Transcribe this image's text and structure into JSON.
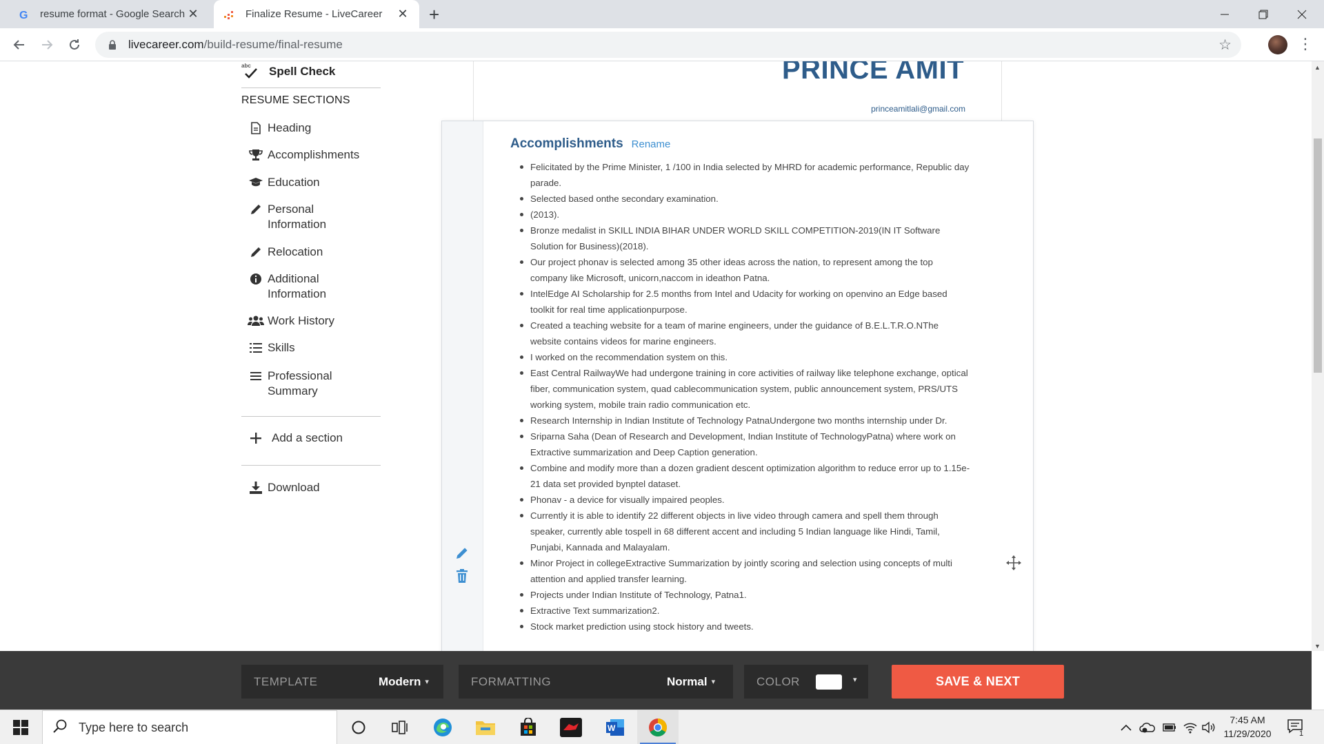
{
  "browser": {
    "tabs": [
      {
        "title": "resume format - Google Search",
        "active": false
      },
      {
        "title": "Finalize Resume - LiveCareer",
        "active": true
      }
    ],
    "url_domain": "livecareer.com",
    "url_path": "/build-resume/final-resume"
  },
  "sidebar": {
    "spell_check": "Spell Check",
    "spell_check_icon_text": "abc",
    "sections_heading": "RESUME SECTIONS",
    "items": [
      {
        "label": "Heading",
        "icon": "document-icon"
      },
      {
        "label": "Accomplishments",
        "icon": "trophy-icon"
      },
      {
        "label": "Education",
        "icon": "graduation-cap-icon"
      },
      {
        "label": "Personal Information",
        "icon": "pencil-icon"
      },
      {
        "label": "Relocation",
        "icon": "pencil-icon"
      },
      {
        "label": "Additional Information",
        "icon": "info-icon"
      },
      {
        "label": "Work History",
        "icon": "users-icon"
      },
      {
        "label": "Skills",
        "icon": "list-icon"
      },
      {
        "label": "Professional Summary",
        "icon": "menu-icon"
      }
    ],
    "add_section": "Add a section",
    "download": "Download"
  },
  "resume": {
    "name": "PRINCE AMIT",
    "email": "princeamitlali@gmail.com",
    "section_title": "Accomplishments",
    "rename_label": "Rename",
    "bullets": [
      "Felicitated by the Prime Minister, 1 /100 in India selected by MHRD for academic performance, Republic day parade.",
      "Selected based onthe secondary examination.",
      "(2013).",
      "Bronze medalist in SKILL INDIA BIHAR UNDER WORLD SKILL COMPETITION-2019(IN IT Software Solution for Business)(2018).",
      "Our project phonav is selected among 35 other ideas across the nation, to represent among the top company like Microsoft, unicorn,naccom in ideathon Patna.",
      "IntelEdge AI Scholarship for 2.5 months from Intel and Udacity for working on openvino an Edge based toolkit for real time applicationpurpose.",
      "Created a teaching website for a team of marine engineers, under the guidance of B.E.L.T.R.O.NThe website contains videos for marine engineers.",
      "I worked on the recommendation system on this.",
      "East Central RailwayWe had undergone training in core activities of railway like telephone exchange, optical fiber, communication system, quad cablecommunication system, public announcement system, PRS/UTS working system, mobile train radio communication etc.",
      "Research Internship in Indian Institute of Technology PatnaUndergone two months internship under Dr.",
      "Sriparna Saha (Dean of Research and Development, Indian Institute of TechnologyPatna) where work on Extractive summarization and Deep Caption generation.",
      "Combine and modify more than a dozen gradient descent optimization algorithm to reduce error up to 1.15e-21 data set provided bynptel dataset.",
      "Phonav - a device for visually impaired peoples.",
      "Currently it is able to identify 22 different objects in live video through camera and spell them through speaker, currently able tospell in 68 different accent and including 5 Indian language like Hindi, Tamil, Punjabi, Kannada and Malayalam.",
      "Minor Project in collegeExtractive Summarization by jointly scoring and selection using concepts of multi attention and applied transfer learning.",
      "Projects under Indian Institute of Technology, Patna1.",
      "Extractive Text summarization2.",
      "Stock market prediction using stock history and tweets."
    ]
  },
  "actionbar": {
    "template_label": "TEMPLATE",
    "template_value": "Modern",
    "formatting_label": "FORMATTING",
    "formatting_value": "Normal",
    "color_label": "COLOR",
    "save_label": "SAVE & NEXT",
    "save_color": "#ef5a44"
  },
  "taskbar": {
    "search_placeholder": "Type here to search",
    "time": "7:45 AM",
    "date": "11/29/2020",
    "notification_count": "1"
  }
}
